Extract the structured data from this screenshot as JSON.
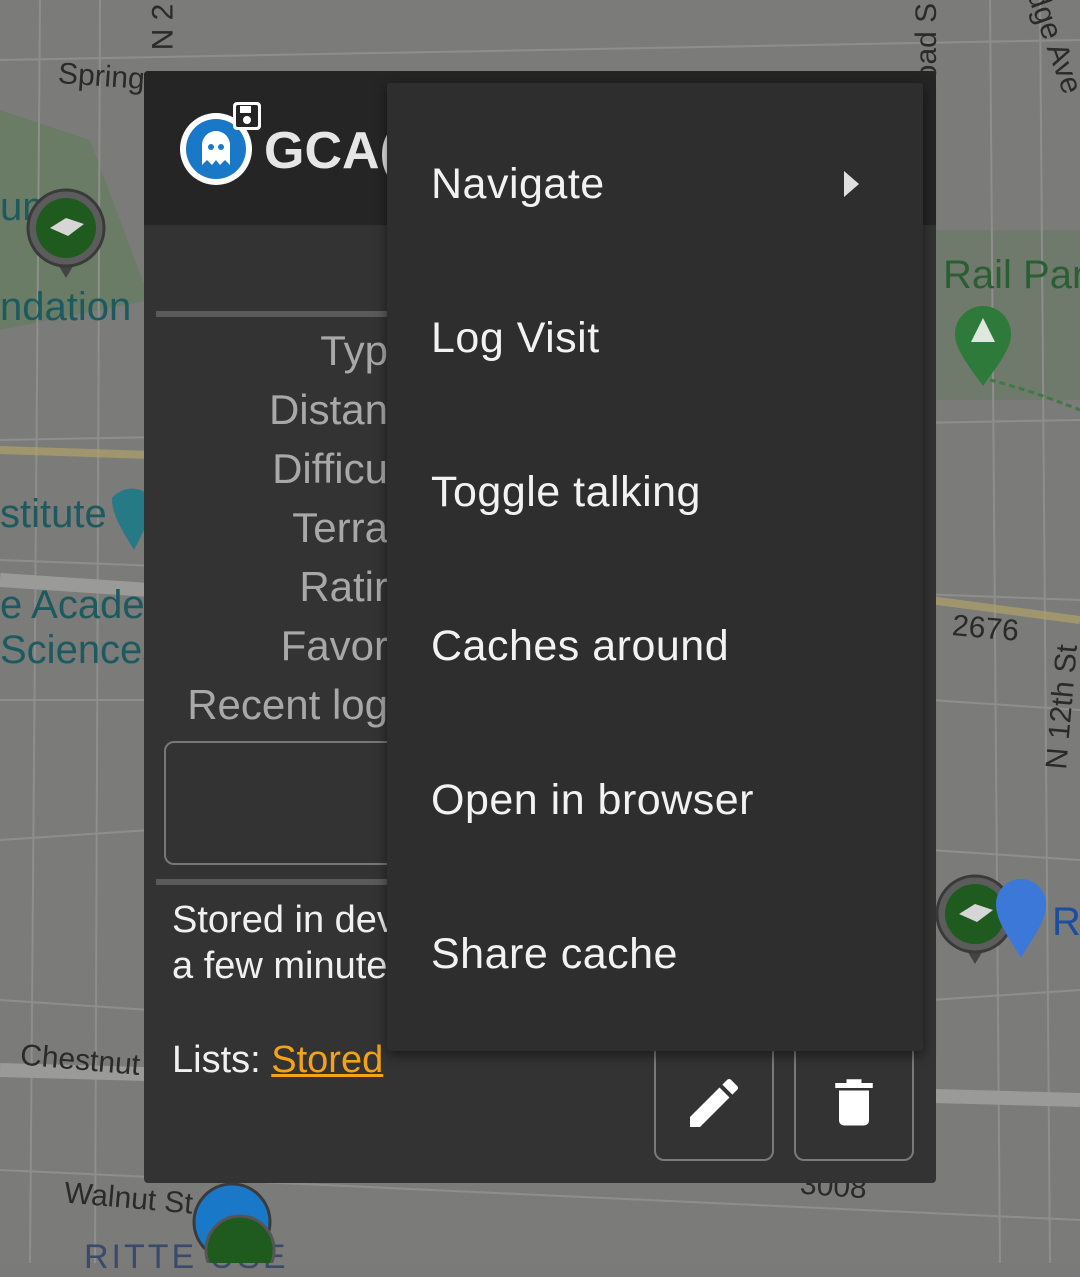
{
  "map": {
    "labels": {
      "spring": "Spring",
      "n2": "N 2",
      "road_s": "oad S",
      "dge_ave": "dge Ave",
      "um": "um",
      "ndation": "ndation",
      "rail_park": "Rail Park",
      "stitute": "stitute",
      "academy": "e Academ",
      "sciences": "Sciences",
      "num_2676": "2676",
      "n12th": "N 12th St",
      "re": "Re",
      "chestnut": "Chestnut S",
      "walnut": "Walnut St",
      "num_3008": "3008",
      "rittenhouse": "RITTE     USE"
    }
  },
  "dialog": {
    "title": "GCA(",
    "fields": {
      "type": "Typ",
      "distance": "Distan",
      "difficulty": "Difficu",
      "terrain": "Terra",
      "rating": "Ratir",
      "favorites": "Favor",
      "recent_logs": "Recent log"
    },
    "stored_line1": "Stored in dev",
    "stored_line2": "a few minute",
    "lists_label": "Lists: ",
    "lists_value": "Stored"
  },
  "menu": {
    "items": [
      {
        "label": "Navigate",
        "has_submenu": true
      },
      {
        "label": "Log Visit"
      },
      {
        "label": "Toggle talking"
      },
      {
        "label": "Caches around"
      },
      {
        "label": "Open in browser"
      },
      {
        "label": "Share cache"
      }
    ]
  },
  "colors": {
    "link": "#f5a316",
    "menu_bg": "#2e2e2e",
    "dialog_bg": "#333333",
    "cache_blue": "#1a78c8"
  },
  "icons": [
    "floppy-icon",
    "ghost-icon",
    "edit-pencil-icon",
    "trash-icon",
    "submenu-arrow-icon",
    "map-marker-icon"
  ]
}
